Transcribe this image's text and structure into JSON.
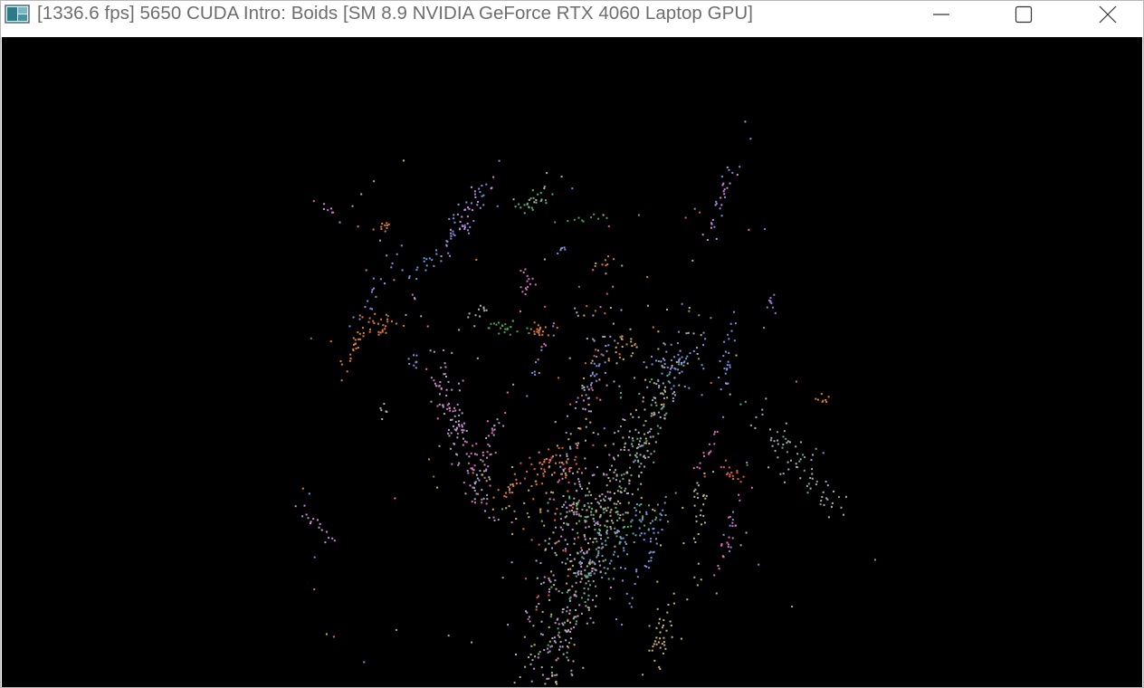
{
  "window": {
    "title": "[1336.6 fps] 5650 CUDA Intro: Boids [SM 8.9 NVIDIA GeForce RTX 4060 Laptop GPU]",
    "controls": {
      "minimize_icon": "minimize-icon",
      "maximize_icon": "maximize-icon",
      "close_icon": "close-icon"
    }
  },
  "viewport": {
    "background": "#000000",
    "boid_palette": [
      "#c98bd9",
      "#7f8fe0",
      "#e07a3a",
      "#5bb07a",
      "#c9b36a",
      "#a9a2c4",
      "#e25b4a",
      "#6a9ad8",
      "#b0b0b0",
      "#d86fb8",
      "#9f6fe0",
      "#4aa050"
    ]
  }
}
